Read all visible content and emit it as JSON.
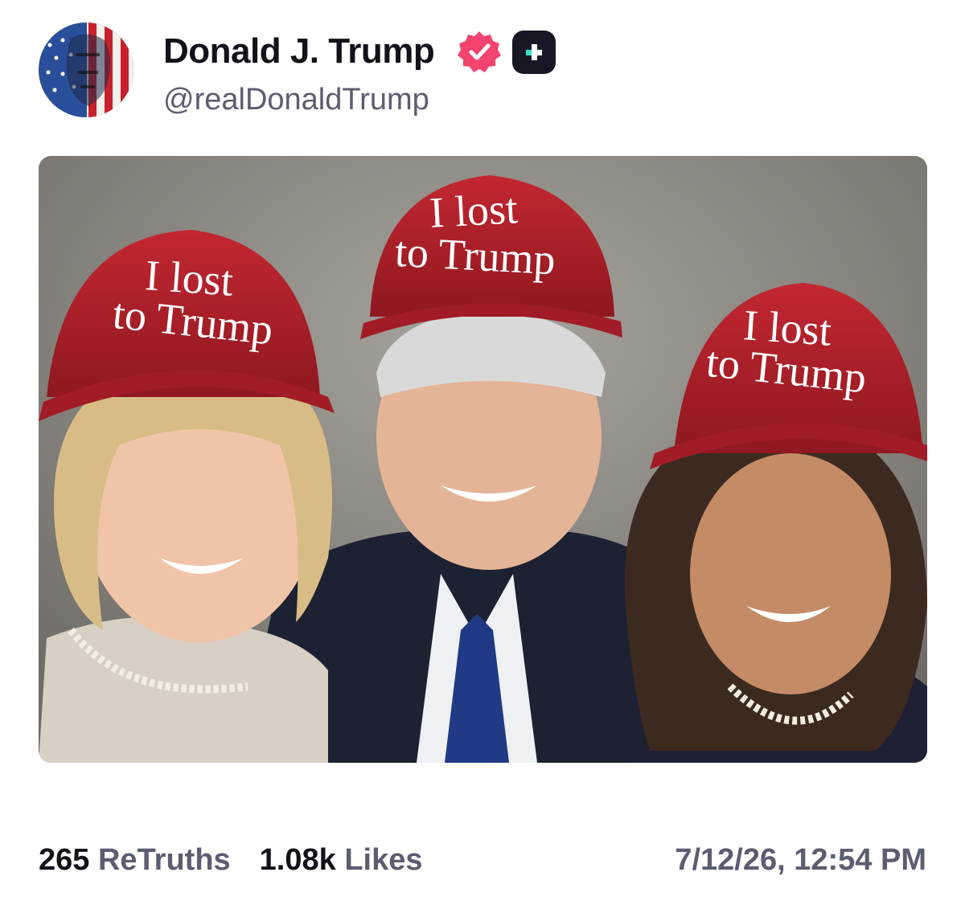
{
  "post": {
    "author": {
      "display_name": "Donald J. Trump",
      "handle": "@realDonaldTrump",
      "verified_icon": "verified-badge-icon",
      "plus_icon": "truth-plus-icon",
      "verified_color": "#f2446e"
    },
    "media": {
      "caps": [
        {
          "line1": "I lost",
          "line2": "to Trump"
        },
        {
          "line1": "I lost",
          "line2": "to Trump"
        },
        {
          "line1": "I lost",
          "line2": "to Trump"
        }
      ],
      "cap_color": "#b0202b"
    },
    "stats": {
      "retruths_count": "265",
      "retruths_label": "ReTruths",
      "likes_count": "1.08k",
      "likes_label": "Likes"
    },
    "timestamp": "7/12/26, 12:54 PM"
  }
}
